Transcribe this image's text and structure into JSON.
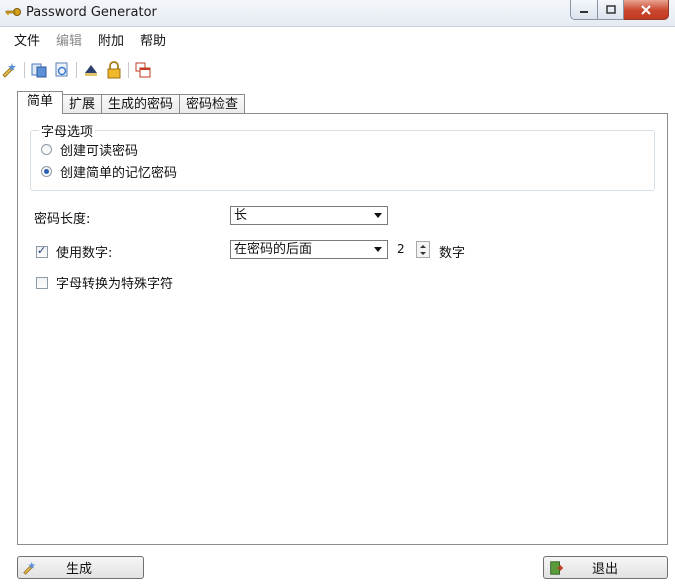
{
  "window": {
    "title": "Password Generator"
  },
  "menu": [
    "文件",
    "编辑",
    "附加",
    "帮助"
  ],
  "tabs": [
    "简单",
    "扩展",
    "生成的密码",
    "密码检查"
  ],
  "options": {
    "group_title": "字母选项",
    "radio_readable": "创建可读密码",
    "radio_simple": "创建简单的记忆密码",
    "length_label": "密码长度:",
    "length_value": "长",
    "use_numbers_label": "使用数字:",
    "number_position": "在密码的后面",
    "number_count": "2",
    "number_unit": "数字",
    "special_chars_label": "字母转换为特殊字符"
  },
  "buttons": {
    "generate": "生成",
    "exit": "退出"
  },
  "colors": {
    "accent": "#2a5fb8",
    "close": "#c9462c"
  }
}
